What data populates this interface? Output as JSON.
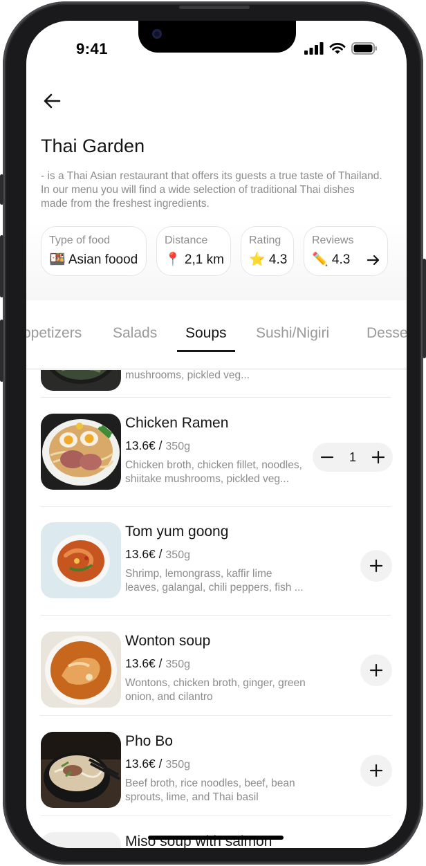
{
  "status_bar": {
    "time": "9:41"
  },
  "restaurant": {
    "name": "Thai Garden",
    "description": "- is a Thai Asian restaurant that offers its guests a true taste of Thailand. In our menu you will find a wide selection of traditional Thai dishes made from the freshest ingredients."
  },
  "chips": [
    {
      "label": "Type of food",
      "value": "🍱 Asian foood"
    },
    {
      "label": "Distance",
      "value": "📍 2,1 km"
    },
    {
      "label": "Rating",
      "value": "⭐ 4.3"
    },
    {
      "label": "Reviews",
      "value": "✏️ 4.3"
    }
  ],
  "tabs": [
    {
      "label": "ppetizers",
      "active": false
    },
    {
      "label": "Salads",
      "active": false
    },
    {
      "label": "Soups",
      "active": true
    },
    {
      "label": "Sushi/Nigiri",
      "active": false
    },
    {
      "label": "Desse",
      "active": false
    }
  ],
  "menu": {
    "partial_top": {
      "desc": "mushrooms, pickled veg..."
    },
    "items": [
      {
        "name": "Chicken Ramen",
        "price": "13.6€ /",
        "weight": "350g",
        "desc": "Chicken broth, chicken fillet, noodles, shiitake mushrooms, pickled veg...",
        "quantity": "1"
      },
      {
        "name": "Tom yum goong",
        "price": "13.6€ /",
        "weight": "350g",
        "desc": "Shrimp, lemongrass, kaffir lime leaves, galangal, chili peppers, fish ..."
      },
      {
        "name": "Wonton soup",
        "price": "13.6€ /",
        "weight": "350g",
        "desc": "Wontons, chicken broth, ginger, green onion, and cilantro"
      },
      {
        "name": "Pho Bo",
        "price": "13.6€ /",
        "weight": "350g",
        "desc": "Beef broth, rice noodles, beef, bean sprouts, lime, and Thai basil"
      },
      {
        "name": "Miso soup with salmon"
      }
    ]
  },
  "icons": {
    "back": "arrow-left-icon",
    "reviews_arrow": "arrow-right-icon",
    "add": "plus-icon",
    "minus": "minus-icon"
  }
}
